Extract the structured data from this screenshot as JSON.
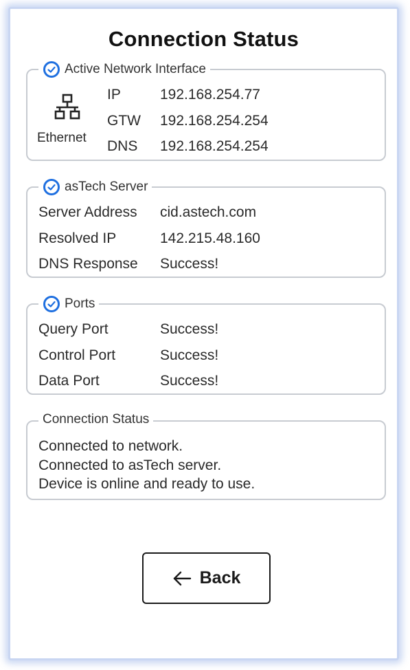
{
  "page": {
    "title": "Connection Status"
  },
  "network": {
    "legend": "Active Network Interface",
    "adapter_label": "Ethernet",
    "adapter_icon": "ethernet-network-icon",
    "rows": [
      {
        "label": "IP",
        "value": "192.168.254.77"
      },
      {
        "label": "GTW",
        "value": "192.168.254.254"
      },
      {
        "label": "DNS",
        "value": "192.168.254.254"
      }
    ]
  },
  "server": {
    "legend": "asTech Server",
    "rows": [
      {
        "label": "Server Address",
        "value": "cid.astech.com"
      },
      {
        "label": "Resolved IP",
        "value": "142.215.48.160"
      },
      {
        "label": "DNS Response",
        "value": "Success!"
      }
    ]
  },
  "ports": {
    "legend": "Ports",
    "rows": [
      {
        "label": "Query Port",
        "value": "Success!"
      },
      {
        "label": "Control Port",
        "value": "Success!"
      },
      {
        "label": "Data Port",
        "value": "Success!"
      }
    ]
  },
  "status": {
    "legend": "Connection Status",
    "lines": [
      "Connected to network.",
      "Connected to asTech server.",
      "Device is online and ready to use."
    ]
  },
  "back_button": {
    "label": "Back",
    "icon": "arrow-left-icon"
  },
  "colors": {
    "accent_blue": "#1e6fe0",
    "panel_border": "#c7cbd1",
    "frame_glow": "#8fa8e6"
  }
}
